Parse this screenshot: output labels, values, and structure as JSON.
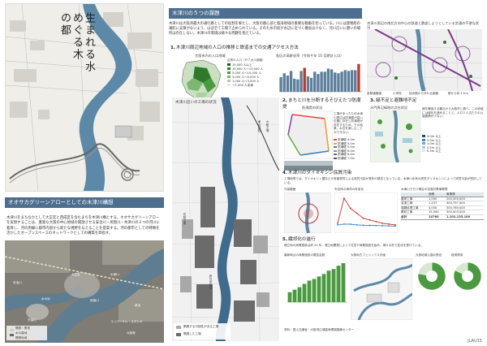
{
  "cover": {
    "title_lines": [
      "生まれる水",
      "めぐる木",
      "の都"
    ]
  },
  "left": {
    "section_title": "オオサカグリーンアローとしての木津川構想",
    "intro_text": "木津川をまちなかとして大正区と西成区を含むまちを木津川構とする。オオサカグリーンアローを実現することは、豊富な大阪の中心地域の開放させる安治川・尻無川・木津川の３つの河川に着目し、河の周縁に都市内部から新たな視野を与えることを提案する。河の都市としての特徴を活かしたオープンスペースのネットワークとしての構築を目指す。",
    "map_labels": [
      "大正区",
      "安治川",
      "尻無川",
      "木の浜",
      "木津川",
      "天保山",
      "ユニバーサル・スタジオ",
      "新浜",
      "大阪港"
    ],
    "map_legend": [
      "開発・業地",
      "木の森地",
      "開発地域"
    ]
  },
  "main": {
    "section_title": "木津川の５つの課題",
    "intro_text": "木津川は大阪湾最大の通行路としての役割を果たし、大阪の都心部と臨海地域の重要な動脈を担っている。川には貨物船の運航に支障がないよう、ほぼ全て工場で占められている。そのため市民が水辺に近づく機会は少なく、河川沿いに憩いの場所は存在しない。木津川の環境は様々な問題を抱えている。",
    "sub1": {
      "num": "1.",
      "title": "木津川周辺地域の人口の推移と鉄道までの交通アクセス方法",
      "map_caption": "大阪市内の人口地域",
      "legend_title": "区別の人口（Ｈ７大人調査）",
      "legend": [
        "15,000 人以上",
        "10,000 人〜15,000 人",
        "5,000 人〜10,000 人",
        "3,000 人〜5,000 人",
        "1,000 人〜3,000 人",
        "〜1,000 人未満"
      ],
      "chart_caption": "各区の高齢化率（令和４年 10 月期計入口）"
    },
    "top_right_caption": "木津川周辺の南北方向中心の鉄道と敷設しようとしている交通の不便な状況",
    "top_right_legend": [
      "各駅通路線",
      "小学校",
      "徒歩圏から外れる距離",
      "駅から約１ｋｍ"
    ],
    "center_map_title": "木津川沿いの工場の状況",
    "center_map_labels": [
      "東京製鐵",
      "大阪工場",
      "佐藤工業",
      "新日本製鐵"
    ],
    "center_map_legend": [
      "関連する可能性がある工場",
      "関連した工場"
    ],
    "sub2": {
      "num": "2.",
      "title": "まちと川を分断するそびえたつ防潮堤",
      "map_caption": "防潮堤の状況",
      "text": "工場があったため木津川周辺は防潮堤が高い位置に存在し防潮堤が存在するため、その結果、水辺を楽しむことができない。",
      "legend": [
        "防潮堤 4.0m",
        "防潮堤 5.0m",
        "防潮堤 5.5m",
        "防潮堤 6.0m",
        "防潮堤 6.4m",
        "防潮堤 7.5m"
      ]
    },
    "sub3": {
      "num": "3.",
      "title": "緑不足と避難地不足",
      "map_caption": "水門周辺緑地の点在状況",
      "text": "緑を確保する観点から大阪市と調べ、この地域には緑化を進めることと、人口１人当たりの公園面積が少ない。",
      "legend": [
        "3.0m 以上",
        "2.0m 以上",
        "1.0m 以上",
        "0.5m 以上",
        "0.3m 以上"
      ]
    },
    "sub4": {
      "num": "4.",
      "title": "木津川のダイオキシン底質汚染",
      "text": "工場地帯では、ダイオキシン類などの有害物質による底質汚染が長年の懸念となっている。木津川水系の底質ダイオキシンによって底質汚染が残存している。",
      "map_caption": "汚染範囲",
      "chart_caption": "市全体の海洋の年変化",
      "table_title": "木津川で行う場合の浚渫対策事業費",
      "table_headers": [
        "",
        "面積",
        "事業費"
      ],
      "table_rows": [
        [
          "護岸工事",
          "1,000",
          "200,300,000"
        ],
        [
          "浚渫工事",
          "1,237",
          "300,797,400"
        ],
        [
          "運搬処理工事",
          "4,000",
          "300,760,000"
        ],
        [
          "覆砂工事",
          "15,000",
          "300,003,000"
        ],
        [
          "合計",
          "14760",
          "1,101,135,100"
        ]
      ]
    },
    "sub5": {
      "num": "5.",
      "title": "織郊化の進行",
      "text": "埋立地の商業施設は約 20 年、埋立地開発によって住宅や商業施設を始め、様々な形で変化を受けている。",
      "chart_caption": "最新時点の商業施設の展覧会数",
      "bottom_map_caption": "大阪地方フェリックス計画",
      "pie_caption": "大阪地域公園の割合",
      "pie_caption2": "経常費用",
      "footer_note": "資料：国土交通省・大阪湾広域臨海環境整備センター"
    }
  },
  "page_number": "JLAU15",
  "colors": {
    "header": "#4d6e8f",
    "river": "#3f6b8c",
    "green": "#4a9a3f",
    "gray": "#8a8880"
  },
  "chart_data": [
    {
      "type": "bar",
      "title": "各区の高齢化率（令和４年 10 月期計入口）",
      "categories": [
        "北区",
        "都島",
        "福島",
        "此花",
        "中央",
        "西区",
        "港区",
        "大正",
        "天王寺",
        "浪速",
        "西淀川",
        "淀川",
        "東淀川",
        "東成",
        "生野",
        "旭区",
        "城東",
        "鶴見",
        "阿倍野",
        "住之江",
        "住吉",
        "東住吉",
        "平野",
        "西成"
      ],
      "values": [
        19,
        24,
        21,
        27,
        17,
        16,
        27,
        31,
        20,
        18,
        26,
        23,
        26,
        26,
        30,
        29,
        25,
        24,
        26,
        28,
        27,
        28,
        28,
        36
      ],
      "ylim": [
        0,
        40
      ]
    },
    {
      "type": "line",
      "title": "市全体の海洋の年変化",
      "x": [
        1997,
        1999,
        2001,
        2003,
        2005,
        2007,
        2009,
        2011,
        2013,
        2015
      ],
      "series": [
        {
          "values": [
            300,
            1800,
            1200,
            900,
            600,
            500,
            400,
            300,
            250,
            200
          ]
        },
        {
          "values": [
            200,
            250,
            240,
            200,
            180,
            170,
            160,
            150,
            140,
            130
          ]
        }
      ]
    },
    {
      "type": "bar",
      "title": "最新時点の商業施設の展覧会数",
      "categories": [
        "H17",
        "H18",
        "H19",
        "H20",
        "H21",
        "H22",
        "H23",
        "H24",
        "H25",
        "H26",
        "H27",
        "H28"
      ],
      "values": [
        12,
        15,
        18,
        22,
        26,
        28,
        31,
        34,
        38,
        40,
        44,
        47
      ],
      "ylim": [
        0,
        50
      ]
    },
    {
      "type": "pie",
      "title": "大阪地域公園の割合",
      "values": [
        78,
        22
      ]
    },
    {
      "type": "pie",
      "title": "経常費用",
      "values": [
        82,
        18
      ]
    }
  ]
}
